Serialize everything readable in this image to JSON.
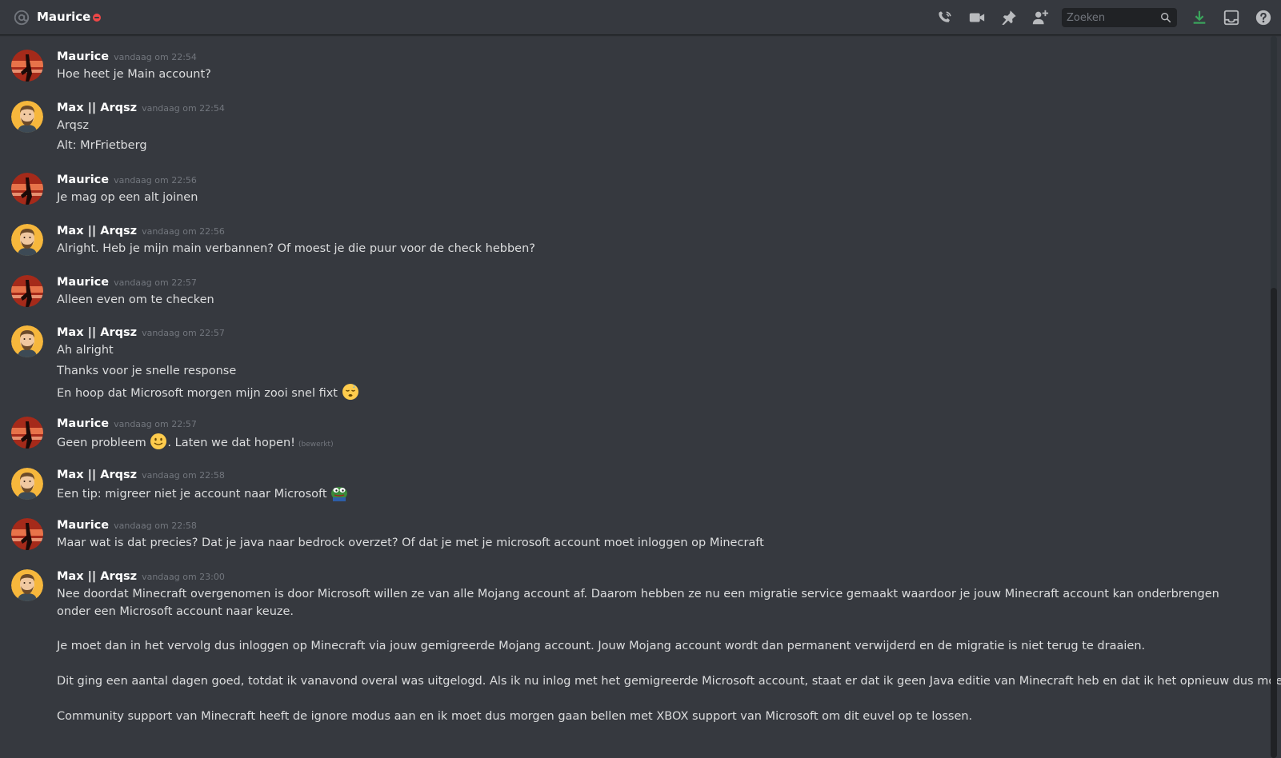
{
  "header": {
    "title": "Maurice",
    "search_placeholder": "Zoeken",
    "icons": [
      "at-icon",
      "dnd-status-icon",
      "call-icon",
      "video-icon",
      "pin-icon",
      "add-member-icon",
      "search-icon",
      "download-icon",
      "inbox-icon",
      "help-icon"
    ]
  },
  "colors": {
    "background": "#36393f",
    "header_border": "#202225",
    "text": "#dcddde",
    "username": "#ffffff",
    "timestamp": "#72767d",
    "dnd": "#f04747",
    "download": "#3ba55c"
  },
  "messages": [
    {
      "author": "Maurice",
      "timestamp": "vandaag om 22:54",
      "lines": [
        "Hoe heet je Main account?"
      ]
    },
    {
      "author": "Max || Arqsz",
      "timestamp": "vandaag om 22:54",
      "lines": [
        "Arqsz",
        "Alt: MrFrietberg"
      ]
    },
    {
      "author": "Maurice",
      "timestamp": "vandaag om 22:56",
      "lines": [
        "Je mag op een alt joinen"
      ]
    },
    {
      "author": "Max || Arqsz",
      "timestamp": "vandaag om 22:56",
      "lines": [
        "Alright. Heb je mijn main verbannen? Of moest je die puur voor de check hebben?"
      ]
    },
    {
      "author": "Maurice",
      "timestamp": "vandaag om 22:57",
      "lines": [
        "Alleen even om te checken"
      ]
    },
    {
      "author": "Max || Arqsz",
      "timestamp": "vandaag om 22:57",
      "lines": [
        "Ah alright",
        "Thanks voor je snelle response",
        "En hoop dat Microsoft morgen mijn zooi snel fixt"
      ]
    },
    {
      "author": "Maurice",
      "timestamp": "vandaag om 22:57",
      "lines": [
        "Geen probleem",
        ". Laten we dat hopen!"
      ],
      "edited": "(bewerkt)"
    },
    {
      "author": "Max || Arqsz",
      "timestamp": "vandaag om 22:58",
      "lines": [
        "Een tip: migreer niet je account naar Microsoft"
      ]
    },
    {
      "author": "Maurice",
      "timestamp": "vandaag om 22:58",
      "lines": [
        "Maar wat is dat precies? Dat je java naar bedrock overzet? Of dat je met je microsoft account moet inloggen op Minecraft"
      ]
    },
    {
      "author": "Max || Arqsz",
      "timestamp": "vandaag om 23:00",
      "lines": [
        "Nee doordat Minecraft overgenomen is door Microsoft willen ze van alle Mojang account af. Daarom hebben ze nu een migratie service gemaakt waardoor je jouw Minecraft account kan onderbrengen onder een Microsoft account naar keuze.",
        "Je moet dan in het vervolg dus inloggen op Minecraft via jouw gemigreerde Mojang account. Jouw Mojang account wordt dan permanent verwijderd en de migratie is niet terug te draaien.",
        "Dit ging een aantal dagen goed, totdat ik vanavond overal was uitgelogd. Als ik nu inlog met het gemigreerde Microsoft account, staat er dat ik geen Java editie van Minecraft heb en dat ik het opnieuw dus moet kopen.",
        "Community support van Minecraft heeft de ignore modus aan en ik moet dus morgen gaan bellen met XBOX support van Microsoft om dit euvel op te lossen."
      ]
    }
  ]
}
